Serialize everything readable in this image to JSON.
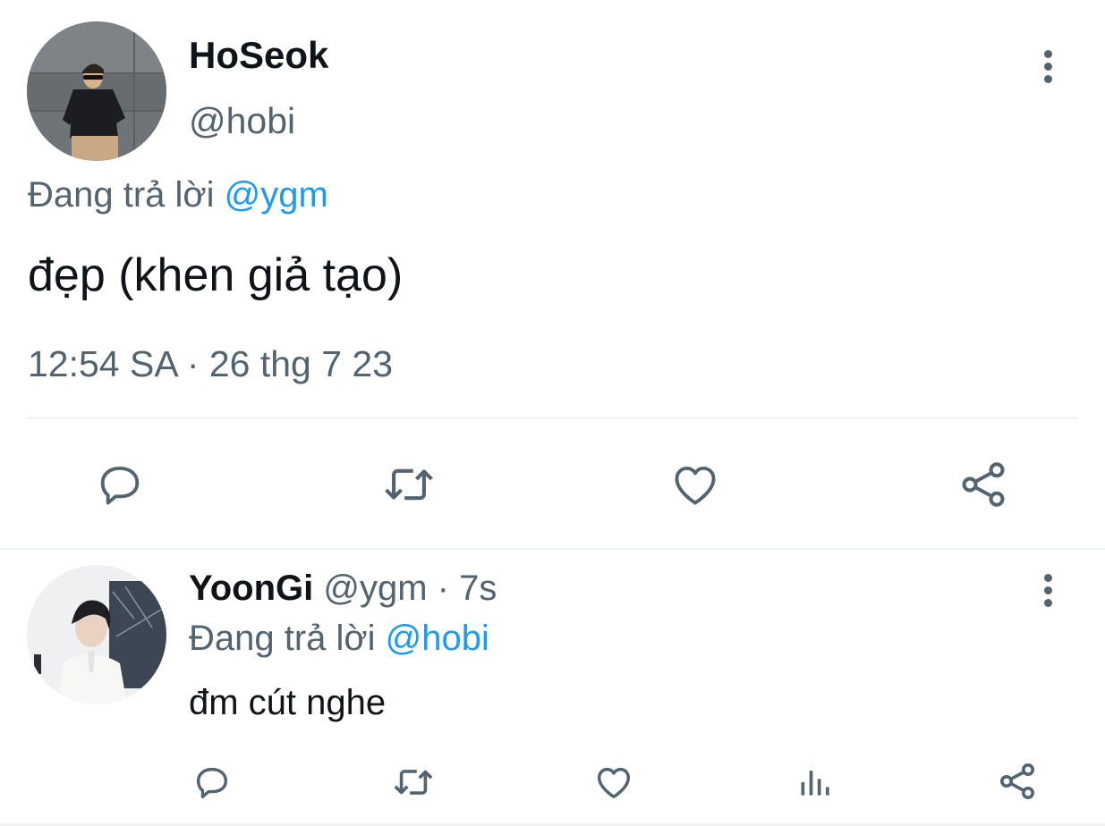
{
  "main_tweet": {
    "display_name": "HoSeok",
    "handle": "@hobi",
    "reply_prefix": "Đang trả lời",
    "reply_to": "@ygm",
    "text": "đẹp (khen giả tạo)",
    "timestamp": "12:54 SA · 26 thg 7 23",
    "actions": [
      "reply-icon",
      "retweet-icon",
      "like-icon",
      "share-icon"
    ]
  },
  "reply_tweet": {
    "display_name": "YoonGi",
    "handle": "@ygm",
    "separator": " · ",
    "time_ago": "7s",
    "reply_prefix": "Đang trả lời",
    "reply_to": "@hobi",
    "text": "đm cút nghe",
    "actions": [
      "reply-icon",
      "retweet-icon",
      "like-icon",
      "analytics-icon",
      "share-icon"
    ]
  },
  "colors": {
    "text_primary": "#0f1419",
    "text_secondary": "#536471",
    "accent": "#1d9bf0",
    "divider": "#eff3f4"
  }
}
